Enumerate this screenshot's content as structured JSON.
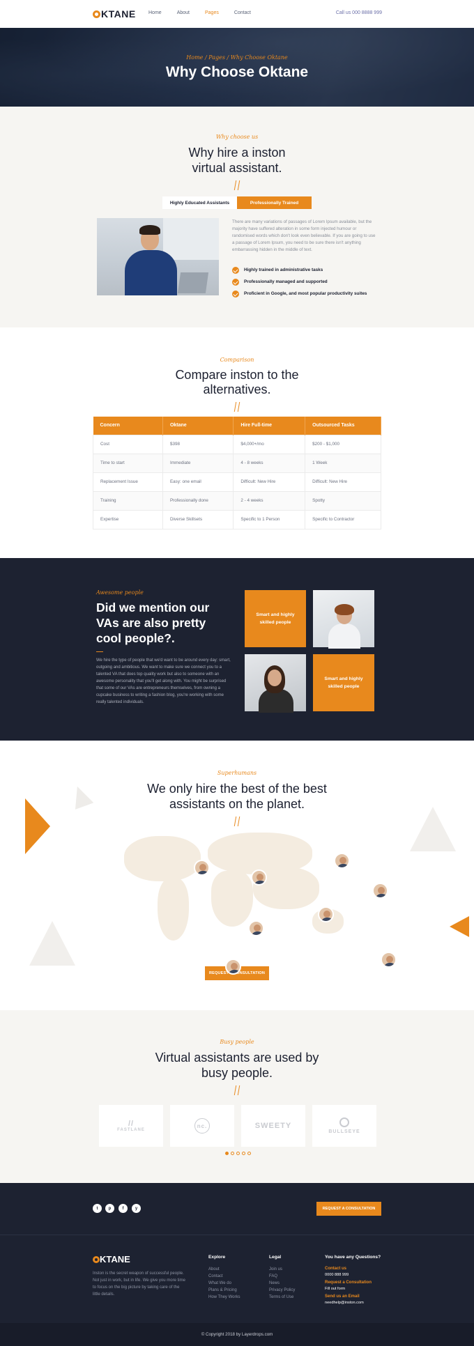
{
  "header": {
    "logo": "KTANE",
    "nav": [
      "Home",
      "About",
      "Pages",
      "Contact"
    ],
    "active_nav": "Pages",
    "call": "Call us 000 8888 999"
  },
  "hero": {
    "breadcrumb": "Home / Pages / Why Choose Oktane",
    "title": "Why Choose Oktane"
  },
  "why": {
    "kicker": "Why choose us",
    "title_line1": "Why hire a inston",
    "title_line2": "virtual assistant.",
    "tabs": [
      "Highly Educated Assistants",
      "Professionally Trained"
    ],
    "paragraph": "There are many variations of passages of Lorem Ipsum available, but the majority have suffered alteration in some form injected humour or randomised words which don't look even believable. If you are going to use a passage of Lorem Ipsum, you need to be sure there isn't anything embarrassing hidden in the middle of text.",
    "checks": [
      "Highly trained in administrative tasks",
      "Professionally managed and supported",
      "Proficient in Google, and most popular productivity suites"
    ]
  },
  "compare": {
    "kicker": "Comparison",
    "title_line1": "Compare inston to the",
    "title_line2": "alternatives.",
    "headers": [
      "Concern",
      "Oktane",
      "Hire Full-time",
      "Outsourced Tasks"
    ],
    "rows": [
      [
        "Cost",
        "$398",
        "$4,000+/mo",
        "$200 - $1,000"
      ],
      [
        "Time to start",
        "Immediate",
        "4 - 8 weeks",
        "1 Week"
      ],
      [
        "Replacement Issue",
        "Easy: one email",
        "Difficult: New Hire",
        "Difficult: New Hire"
      ],
      [
        "Training",
        "Professionally done",
        "2 - 4 weeks",
        "Spotty"
      ],
      [
        "Expertise",
        "Diverse Skillsets",
        "Specific to 1 Person",
        "Specific to Contractor"
      ]
    ]
  },
  "people": {
    "kicker": "Awesome people",
    "title_line1": "Did we mention our",
    "title_line2": "VAs are also pretty",
    "title_line3": "cool people?.",
    "paragraph": "We hire the type of people that we'd want to be around every day: smart, outgoing and ambitious. We want to make sure we connect you to a talented VA that does top quality work but also to someone with an awesome personality that you'll get along with. You might be surprised that some of our VAs are entrepreneurs themselves, from owning a cupcake business to writing a fashion blog, you're working with some really talented individuals.",
    "tile1": "Smart and highly skilled people",
    "tile2": "Smart and highly skilled people"
  },
  "best": {
    "kicker": "Superhumans",
    "title_line1": "We only hire the best of the best",
    "title_line2": "assistants on the planet.",
    "button": "REQUEST A CONSULTATION"
  },
  "busy": {
    "kicker": "Busy people",
    "title_line1": "Virtual assistants are used by",
    "title_line2": "busy people.",
    "logos": [
      "FASTLANE",
      "nc.",
      "SWEETY",
      "BULLSEYE"
    ]
  },
  "footer": {
    "social": [
      "t",
      "p",
      "f",
      "y"
    ],
    "cta": "REQUEST A CONSULTATION",
    "logo": "KTANE",
    "about": "Inston is the secret weapon of successful people. Not just in work, but in life. We give you more time to focus on the big picture by taking care of the little details.",
    "explore_title": "Explore",
    "explore": [
      "About",
      "Contact",
      "What We do",
      "Plans & Pricing",
      "How They Works"
    ],
    "legal_title": "Legal",
    "legal": [
      "Join us",
      "FAQ",
      "News",
      "Privacy Policy",
      "Terms of Use"
    ],
    "questions_title": "You have any Questions?",
    "contact_label": "Contact us",
    "contact_value": "0000 888 999",
    "request_label": "Request a Consultation",
    "request_value": "Fill out form",
    "email_label": "Send us an Email",
    "email_value": "needhelp@inston.com",
    "copyright": "© Copyright 2018 by Layerdrops.com"
  },
  "colors": {
    "accent": "#e8891d",
    "dark": "#1d2231",
    "light": "#f6f5f2"
  }
}
